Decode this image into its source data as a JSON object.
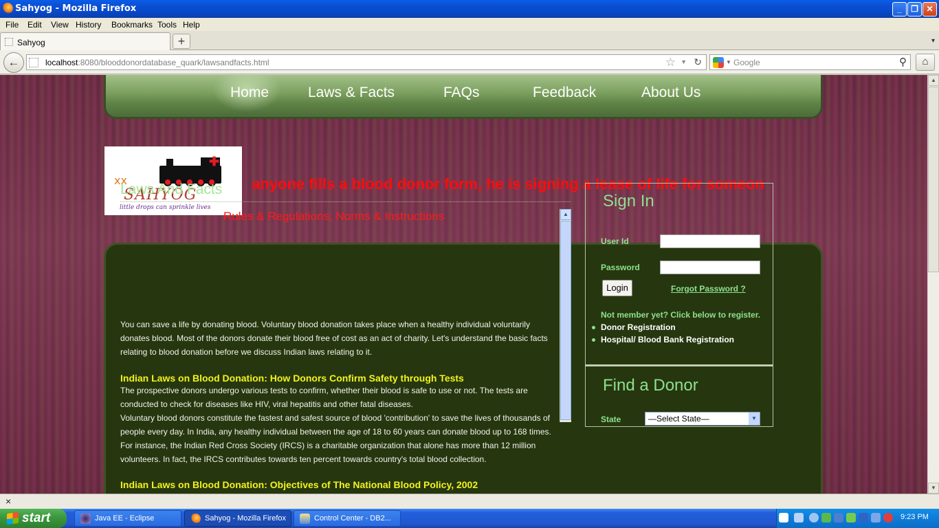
{
  "window": {
    "title": "Sahyog - Mozilla Firefox",
    "controls": [
      "minimize",
      "maximize",
      "close"
    ]
  },
  "menubar": {
    "items": [
      "File",
      "Edit",
      "View",
      "History",
      "Bookmarks",
      "Tools",
      "Help"
    ]
  },
  "tabs": {
    "active_label": "Sahyog",
    "new_tab_label": "+"
  },
  "navigation": {
    "url_host": "localhost",
    "url_rest": ":8080/blooddonordatabase_quark/lawsandfacts.html",
    "search_placeholder": "Google"
  },
  "site": {
    "nav": [
      "Home",
      "Laws & Facts",
      "FAQs",
      "Feedback",
      "About Us"
    ],
    "logo": {
      "brand": "SAHYOG",
      "tagline": "little drops can sprinkle lives"
    },
    "marquee": "ı anyone fills a blood donor form, he is signing a lease of life for someon",
    "section_title": "Laws And Facts",
    "article": {
      "subtitle": "Rules & Regulations; Norms & Instructions",
      "intro": "You can save a life by donating blood. Voluntary blood donation takes place when a healthy individual voluntarily donates blood. Most of the donors donate their blood free of cost as an act of charity. Let's understand the basic facts relating to blood donation before we discuss Indian laws relating to it.",
      "heading1": "Indian Laws on Blood Donation:  How Donors Confirm Safety through Tests",
      "para1": "The prospective donors undergo various tests to confirm, whether their blood is safe to use or not. The tests are conducted to check for diseases like HIV, viral hepatitis and other fatal diseases.",
      "para2": "Voluntary blood donors constitute the fastest and safest source of blood 'contribution' to save the lives of thousands of people every day. In India, any healthy individual between the age of 18 to 60 years can donate blood up to 168 times. For instance, the Indian Red Cross Society (IRCS) is a charitable organization that alone has more than 12 million volunteers. In fact, the IRCS contributes towards ten percent towards country's total blood collection.",
      "heading2": "Indian Laws on Blood Donation: Objectives of The National Blood Policy, 2002"
    },
    "signin": {
      "title": "Sign In",
      "user_label": "User Id",
      "password_label": "Password",
      "user_value": "",
      "password_value": "",
      "login_button": "Login",
      "forgot_link": "Forgot Password ?",
      "not_member": "Not member yet? Click below to register.",
      "donor_reg": "Donor Registration",
      "hospital_reg": "Hospital/ Blood Bank Registration"
    },
    "finder": {
      "title": "Find a Donor",
      "state_label": "State",
      "state_value": "—Select State—"
    }
  },
  "statusbar": {
    "close_label": "×"
  },
  "taskbar": {
    "start_label": "start",
    "tasks": [
      "Java EE - Eclipse",
      "Sahyog - Mozilla Firefox",
      "Control Center - DB2..."
    ],
    "clock": "9:23 PM"
  },
  "colors": {
    "page_bg": "#6b2c43",
    "panel_bg": "#26370f",
    "nav_green": "#7da160",
    "accent_green": "#8ee08e",
    "heading_yellow": "#f3f31f",
    "marquee_red": "#ff0c0c"
  }
}
